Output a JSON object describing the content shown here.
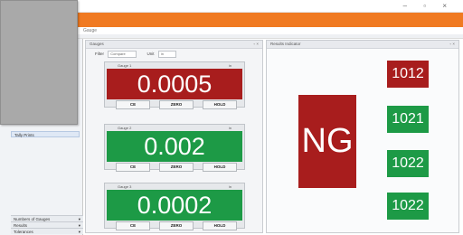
{
  "menu": {
    "item": "Gauge"
  },
  "window": {
    "controls": "– ▫ ×"
  },
  "nav": {
    "selected_item": "Tally Prints",
    "footer_items": [
      "Numbers of Gauges",
      "Results",
      "Tolerances"
    ]
  },
  "left_panel": {
    "title": "Gauges",
    "controls": "▫ ×",
    "filter_label_1": "Filter",
    "filter_value_1": "Compare",
    "filter_label_2": "Unit",
    "filter_value_2": "in"
  },
  "right_panel": {
    "title": "Results Indicator",
    "controls": "▫ ×"
  },
  "cards": [
    {
      "label": "Gauge 1",
      "unit": "in",
      "value": "0.0005",
      "status_color": "#a81d1d",
      "buttons": [
        "CE",
        "ZERO",
        "HOLD"
      ]
    },
    {
      "label": "Gauge 2",
      "unit": "in",
      "value": "0.002",
      "status_color": "#1d9a46",
      "buttons": [
        "CE",
        "ZERO",
        "HOLD"
      ]
    },
    {
      "label": "Gauge 3",
      "unit": "in",
      "value": "0.0002",
      "status_color": "#1d9a46",
      "buttons": [
        "CE",
        "ZERO",
        "HOLD"
      ]
    }
  ],
  "overall_status": {
    "text": "NG",
    "color": "#a81d1d"
  },
  "codes": [
    {
      "text": "1012",
      "color": "#a81d1d"
    },
    {
      "text": "1021",
      "color": "#1d9a46"
    },
    {
      "text": "1022",
      "color": "#1d9a46"
    },
    {
      "text": "1022",
      "color": "#1d9a46"
    }
  ],
  "colors": {
    "accent": "#f07a22",
    "ng_red": "#a81d1d",
    "ok_green": "#1d9a46"
  }
}
